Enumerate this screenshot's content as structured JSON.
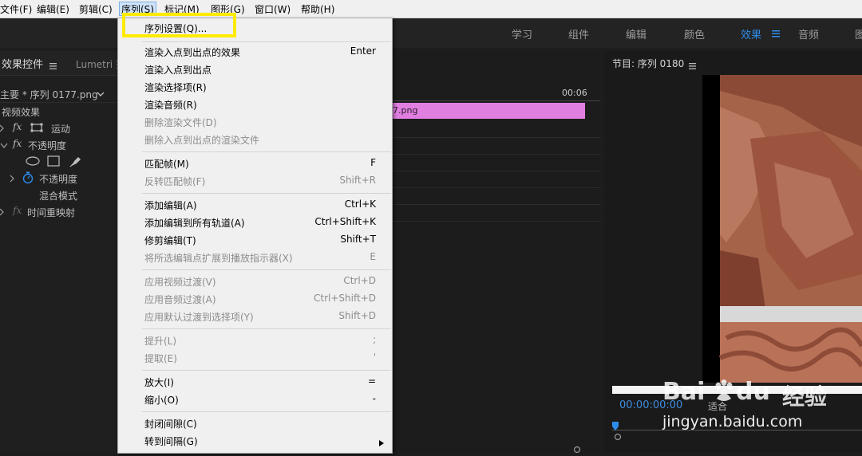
{
  "menubar": {
    "file": "文件(F)",
    "edit": "编辑(E)",
    "clip": "剪辑(C)",
    "sequence": "序列(S)",
    "markers": "标记(M)",
    "graphics": "图形(G)",
    "window": "窗口(W)",
    "help": "帮助(H)"
  },
  "workspaces": {
    "learn": "学习",
    "assembly": "组件",
    "editing": "编辑",
    "color": "颜色",
    "effects": "效果",
    "audio": "音频",
    "graphics": "图"
  },
  "effect_controls": {
    "tab": "效果控件",
    "lumetri_tab": "Lumetri 范",
    "source": "主要 * 序列 0177.png",
    "video_effects": "视频效果",
    "motion": "运动",
    "opacity": "不透明度",
    "opacity_param": "不透明度",
    "blend_mode": "混合模式",
    "time_remap": "时间重映射"
  },
  "timeline": {
    "timecode_label": "00:06",
    "clip_name": "7.png",
    "clip_color": "#e07fe0"
  },
  "program_monitor": {
    "title": "节目: 序列 0180",
    "timecode": "00:00:00:00",
    "fit_label": "适合"
  },
  "sequence_menu": {
    "items": [
      {
        "label": "序列设置(Q)...",
        "shortcut": "",
        "enabled": true,
        "highlighted": true
      },
      {
        "label": "渲染入点到出点的效果",
        "shortcut": "Enter",
        "enabled": true
      },
      {
        "label": "渲染入点到出点",
        "shortcut": "",
        "enabled": true
      },
      {
        "label": "渲染选择项(R)",
        "shortcut": "",
        "enabled": true
      },
      {
        "label": "渲染音频(R)",
        "shortcut": "",
        "enabled": true
      },
      {
        "label": "删除渲染文件(D)",
        "shortcut": "",
        "enabled": false
      },
      {
        "label": "删除入点到出点的渲染文件",
        "shortcut": "",
        "enabled": false
      },
      {
        "label": "匹配帧(M)",
        "shortcut": "F",
        "enabled": true
      },
      {
        "label": "反转匹配帧(F)",
        "shortcut": "Shift+R",
        "enabled": false
      },
      {
        "label": "添加编辑(A)",
        "shortcut": "Ctrl+K",
        "enabled": true
      },
      {
        "label": "添加编辑到所有轨道(A)",
        "shortcut": "Ctrl+Shift+K",
        "enabled": true
      },
      {
        "label": "修剪编辑(T)",
        "shortcut": "Shift+T",
        "enabled": true
      },
      {
        "label": "将所选编辑点扩展到播放指示器(X)",
        "shortcut": "E",
        "enabled": false
      },
      {
        "label": "应用视频过渡(V)",
        "shortcut": "Ctrl+D",
        "enabled": false
      },
      {
        "label": "应用音频过渡(A)",
        "shortcut": "Ctrl+Shift+D",
        "enabled": false
      },
      {
        "label": "应用默认过渡到选择项(Y)",
        "shortcut": "Shift+D",
        "enabled": false
      },
      {
        "label": "提升(L)",
        "shortcut": ";",
        "enabled": false
      },
      {
        "label": "提取(E)",
        "shortcut": "'",
        "enabled": false
      },
      {
        "label": "放大(I)",
        "shortcut": "=",
        "enabled": true
      },
      {
        "label": "缩小(O)",
        "shortcut": "-",
        "enabled": true
      },
      {
        "label": "封闭间隙(C)",
        "shortcut": "",
        "enabled": true
      },
      {
        "label": "转到间隔(G)",
        "shortcut": "",
        "enabled": true,
        "submenu": true
      }
    ]
  },
  "watermark": {
    "brand": "Bai",
    "brand2": "du",
    "cn": "经验",
    "url": "jingyan.baidu.com"
  },
  "colors": {
    "accent": "#2d8ceb",
    "highlight_box": "#ffeb00",
    "timecode_blue": "#3d8de0"
  }
}
